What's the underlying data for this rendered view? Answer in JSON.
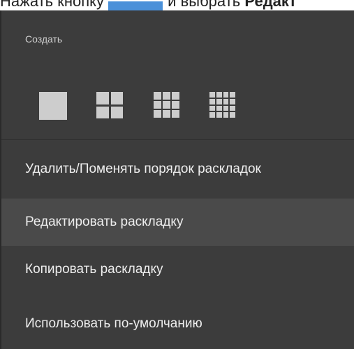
{
  "instruction": {
    "prefix": "Нажать кнопку",
    "middle": "и выбрать",
    "bold_target": "Редакт"
  },
  "menu": {
    "section_title": "Создать",
    "layouts": [
      {
        "name": "1x1",
        "icon": "layout-1x1-icon"
      },
      {
        "name": "2x2",
        "icon": "layout-2x2-icon"
      },
      {
        "name": "3x3",
        "icon": "layout-3x3-icon"
      },
      {
        "name": "4x4",
        "icon": "layout-4x4-icon"
      }
    ],
    "items": [
      {
        "label": "Удалить/Поменять порядок раскладок"
      },
      {
        "label": "Редактировать раскладку",
        "highlighted": true
      },
      {
        "label": "Копировать раскладку"
      },
      {
        "label": "Использовать по-умолчанию"
      }
    ],
    "colors": {
      "background": "#3c3c3c",
      "highlight": "#4a4a4a",
      "icon": "#cdcdcd",
      "text": "#eeeeee"
    }
  }
}
